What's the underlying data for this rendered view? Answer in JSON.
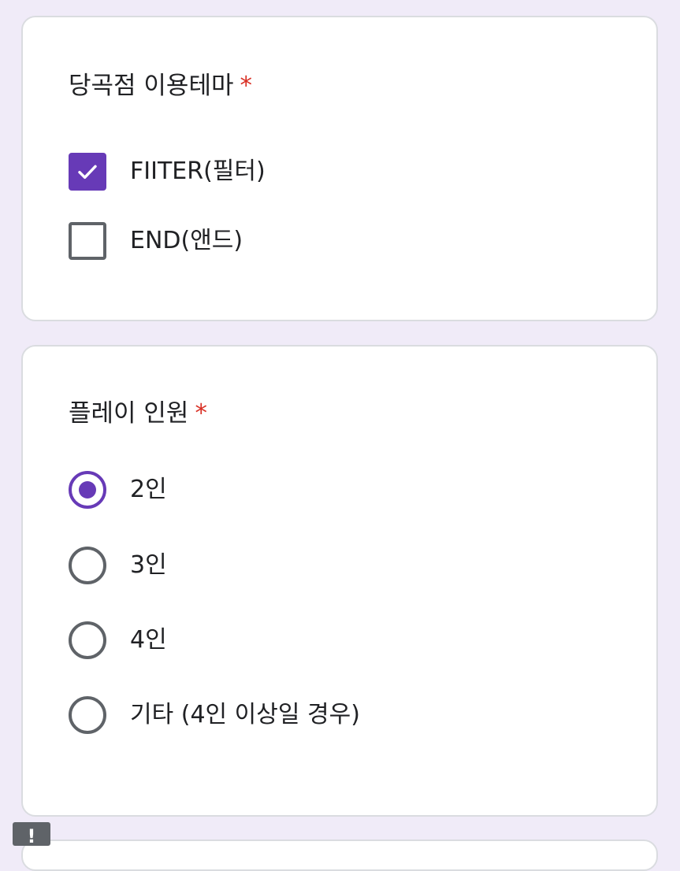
{
  "questions": [
    {
      "title": "당곡점 이용테마",
      "required_mark": "*",
      "type": "checkbox",
      "options": [
        {
          "label": "FIITER(필터)",
          "checked": true
        },
        {
          "label": "END(앤드)",
          "checked": false
        }
      ]
    },
    {
      "title": "플레이 인원",
      "required_mark": "*",
      "type": "radio",
      "options": [
        {
          "label": "2인",
          "checked": true
        },
        {
          "label": "3인",
          "checked": false
        },
        {
          "label": "4인",
          "checked": false
        },
        {
          "label": "기타 (4인 이상일 경우)",
          "checked": false
        }
      ]
    }
  ],
  "alert_badge": {
    "text": "!",
    "icon": "alert-icon"
  },
  "colors": {
    "background": "#f0ebf8",
    "accent": "#673ab7",
    "required": "#d93025",
    "unchecked": "#5f6368",
    "card_border": "#dadce0"
  }
}
